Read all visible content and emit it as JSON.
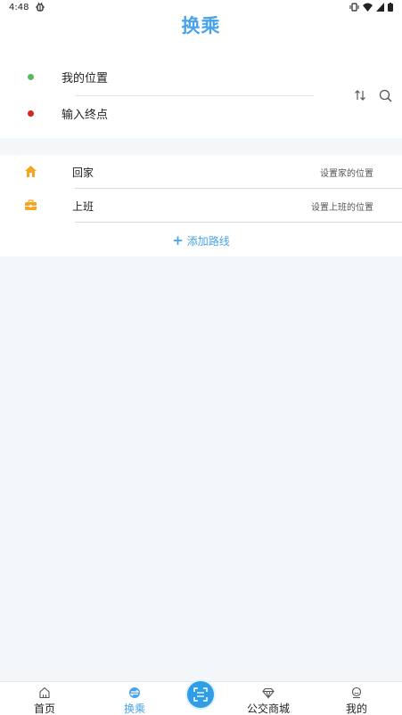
{
  "status_bar": {
    "time": "4:48"
  },
  "header": {
    "title": "换乘"
  },
  "route": {
    "origin": "我的位置",
    "destination": "输入终点",
    "origin_color": "#5cb85c",
    "destination_color": "#d9251c"
  },
  "shortcuts": {
    "items": [
      {
        "label": "回家",
        "hint": "设置家的位置",
        "icon": "home-icon"
      },
      {
        "label": "上班",
        "hint": "设置上班的位置",
        "icon": "briefcase-icon"
      }
    ],
    "add_label": "添加路线"
  },
  "tabbar": {
    "items": [
      {
        "label": "首页",
        "icon": "home-outline-icon"
      },
      {
        "label": "换乘",
        "icon": "transfer-icon",
        "active": true
      },
      {
        "label": "",
        "icon": "scan-icon"
      },
      {
        "label": "公交商城",
        "icon": "diamond-icon"
      },
      {
        "label": "我的",
        "icon": "user-icon"
      }
    ]
  },
  "colors": {
    "accent": "#4aa3e8",
    "shortcut_icon": "#f5a623"
  }
}
